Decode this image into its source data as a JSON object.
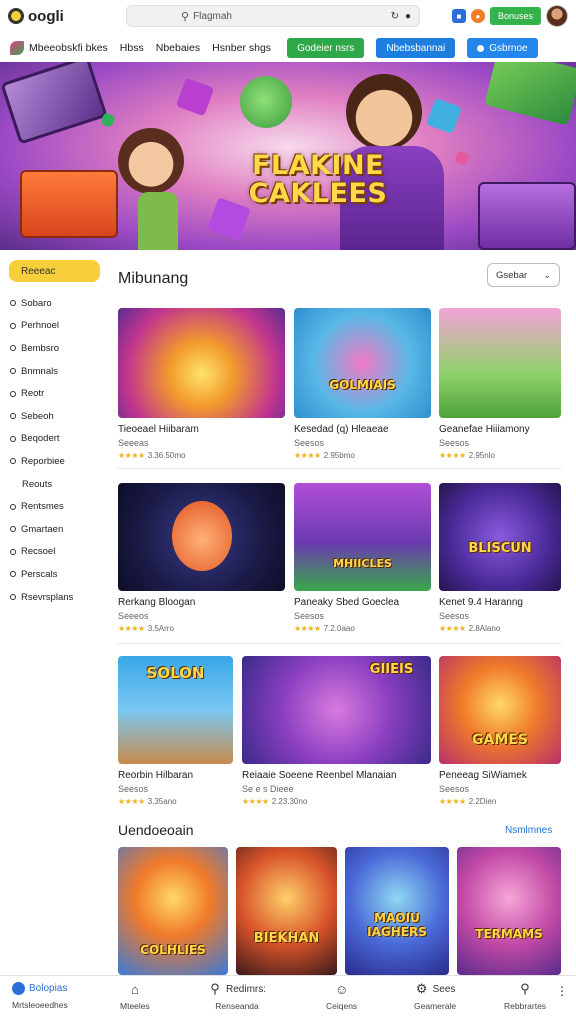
{
  "header": {
    "logo_text": "oogli",
    "search_placeholder": "Flagmah",
    "badge_label": "Bonuses",
    "icons": [
      "logo-icon",
      "search-icon",
      "refresh-icon",
      "dot-icon",
      "blue-square-icon",
      "orange-circle-icon",
      "avatar"
    ]
  },
  "nav": {
    "brand": "Mbeeobskfi bkes",
    "links": [
      "Hbss",
      "Nbebaies",
      "Hsnber shgs"
    ],
    "buttons": [
      "Godeier nsrs",
      "Nbebsbannai",
      "Gsbrnoe"
    ]
  },
  "hero": {
    "title": "FLAKINE CAKLEES"
  },
  "sidebar": {
    "active": "Reeeac",
    "items": [
      "Sobaro",
      "Perhnoel",
      "Bembsro",
      "Bnmnals",
      "Reotr",
      "Sebeoh",
      "Beqodert",
      "Reporbiee",
      "Reouts",
      "Rentsmes",
      "Gmartaen",
      "Recsoel",
      "Perscals",
      "Rsevrsplans"
    ]
  },
  "section1": {
    "title": "Mibunang",
    "sort_label": "Gsebar",
    "cards": [
      {
        "title": "Tieoeael Hiibaram",
        "sub": "Seeeas",
        "rating": "3.36.50mo"
      },
      {
        "title": "Kesedad (q) Hleaeae",
        "sub": "Seesos",
        "rating": "2.95bmo"
      },
      {
        "title": "Geanefae Hiiiamony",
        "sub": "Seesos",
        "rating": "2.95nlo"
      },
      {
        "title": "Rerkang Bloogan",
        "sub": "Seeeos",
        "rating": "3.5Arro"
      },
      {
        "title": "Paneaky Sbed  Goeclea",
        "sub": "Seesos",
        "rating": "7.2.0aao"
      },
      {
        "title": "Kenet 9.4 Haranng",
        "sub": "Seesos",
        "rating": "2.8Alano"
      },
      {
        "title": "Reorbin Hilbaran",
        "sub": "Seesos",
        "rating": "3.35ano"
      },
      {
        "title": "Reiaaie Soeene Reenbel Mlanaian",
        "sub": "Se e s Dieee",
        "rating": "2.23.30no"
      },
      {
        "title": "Peneeag SiWiamek",
        "sub": "Seesos",
        "rating": "2.2Dien"
      }
    ],
    "thumb_labels": [
      "",
      "GOLMIAIS",
      "",
      "",
      "MHIICLES",
      "BLISCUN",
      "SOLON",
      "GIIEIS",
      "GAMES"
    ]
  },
  "section2": {
    "title": "Uendoeoain",
    "see_all": "Nsmlmnes",
    "thumb_labels": [
      "COLHLIES",
      "BIEKHAN",
      "MAOIU IAGHERS",
      "TERMAMS"
    ]
  },
  "bottom_nav": [
    {
      "label": "Bolopias",
      "sub": "Mrtsleoeedhes",
      "icon": "home-icon"
    },
    {
      "label": "",
      "sub": "Mteeles",
      "icon": "house-icon"
    },
    {
      "label": "Redimrs:",
      "sub": "Renseanda",
      "icon": "search-icon"
    },
    {
      "label": "",
      "sub": "Ceiqens",
      "icon": "person-icon"
    },
    {
      "label": "Sees",
      "sub": "Geamerale",
      "icon": "settings-icon"
    },
    {
      "label": "",
      "sub": "Rebbrartes",
      "icon": "profile-icon"
    }
  ],
  "colors": {
    "accent_yellow": "#f7cf3a",
    "green": "#2fa84a",
    "blue": "#1c7fe0",
    "link": "#1c6fd6"
  }
}
